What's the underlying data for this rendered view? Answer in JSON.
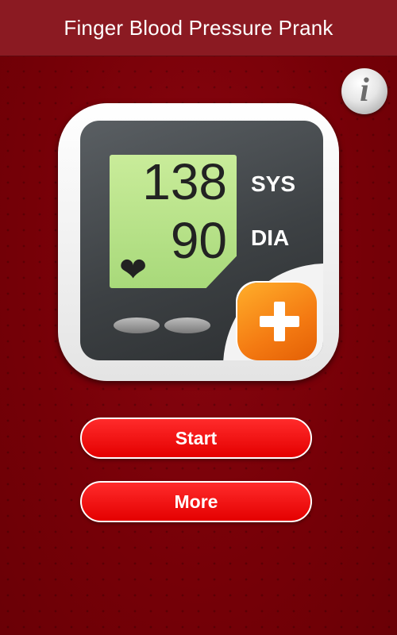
{
  "header": {
    "title": "Finger Blood Pressure Prank"
  },
  "info_button": {
    "glyph": "i",
    "icon": "info-icon"
  },
  "monitor": {
    "systolic": "138",
    "diastolic": "90",
    "sys_label": "SYS",
    "dia_label": "DIA",
    "heart_glyph": "❤",
    "plus_icon": "plus-icon"
  },
  "buttons": {
    "start": "Start",
    "more": "More"
  },
  "colors": {
    "background": "#7d0008",
    "header": "#8b1a22",
    "button": "#ff1010",
    "lcd": "#b8e38a",
    "plus_badge": "#f47a12"
  }
}
